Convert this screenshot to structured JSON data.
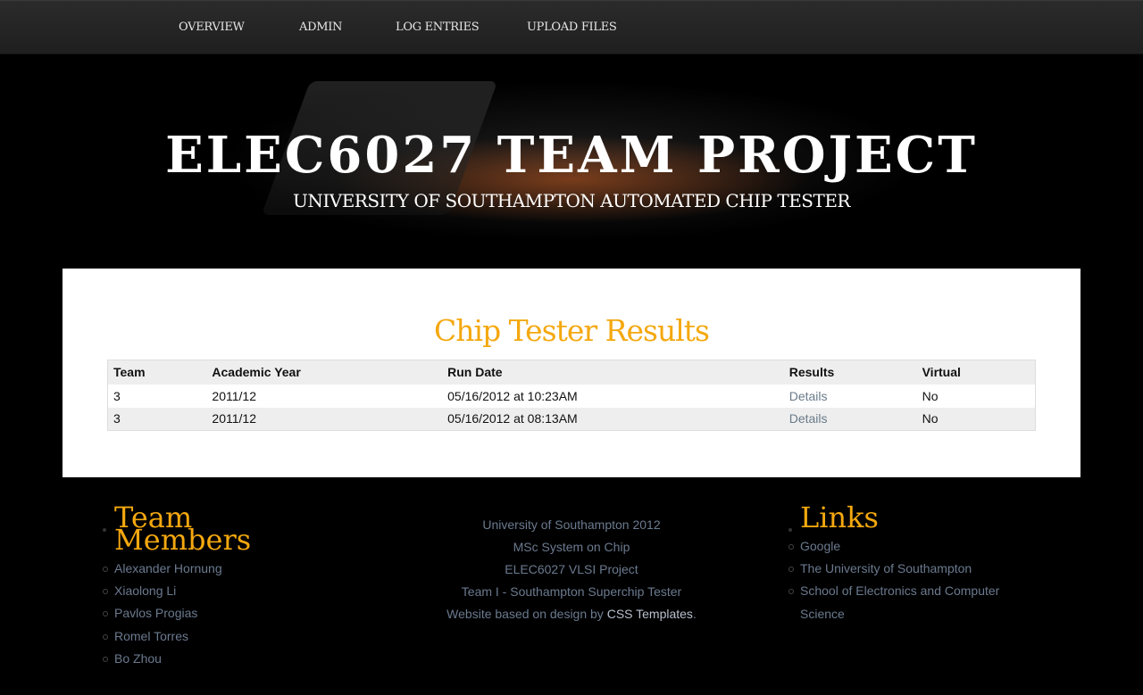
{
  "nav": {
    "items": [
      {
        "label": "OVERVIEW"
      },
      {
        "label": "ADMIN"
      },
      {
        "label": "LOG ENTRIES"
      },
      {
        "label": "UPLOAD FILES"
      }
    ]
  },
  "header": {
    "title": "ELEC6027 TEAM PROJECT",
    "subtitle": "UNIVERSITY OF SOUTHAMPTON AUTOMATED CHIP TESTER"
  },
  "main": {
    "heading": "Chip Tester Results",
    "table": {
      "headers": [
        "Team",
        "Academic Year",
        "Run Date",
        "Results",
        "Virtual"
      ],
      "rows": [
        {
          "team": "3",
          "year": "2011/12",
          "run_date": "05/16/2012 at 10:23AM",
          "results": "Details",
          "virtual": "No"
        },
        {
          "team": "3",
          "year": "2011/12",
          "run_date": "05/16/2012 at 08:13AM",
          "results": "Details",
          "virtual": "No"
        }
      ]
    }
  },
  "footer": {
    "team": {
      "heading": "Team Members",
      "members": [
        "Alexander Hornung",
        "Xiaolong Li",
        "Pavlos Progias",
        "Romel Torres",
        "Bo Zhou"
      ]
    },
    "center": {
      "lines": [
        "University of Southampton 2012",
        "MSc System on Chip",
        "ELEC6027 VLSI Project",
        "Team I - Southampton Superchip Tester"
      ],
      "credit_prefix": "Website based on design by ",
      "credit_link": "CSS Templates",
      "credit_suffix": "."
    },
    "links": {
      "heading": "Links",
      "items": [
        "Google",
        "The University of Southampton",
        "School of Electronics and Computer Science"
      ]
    }
  },
  "colors": {
    "accent": "#f4a80f",
    "link": "#6b7a8f",
    "background": "#000000"
  }
}
